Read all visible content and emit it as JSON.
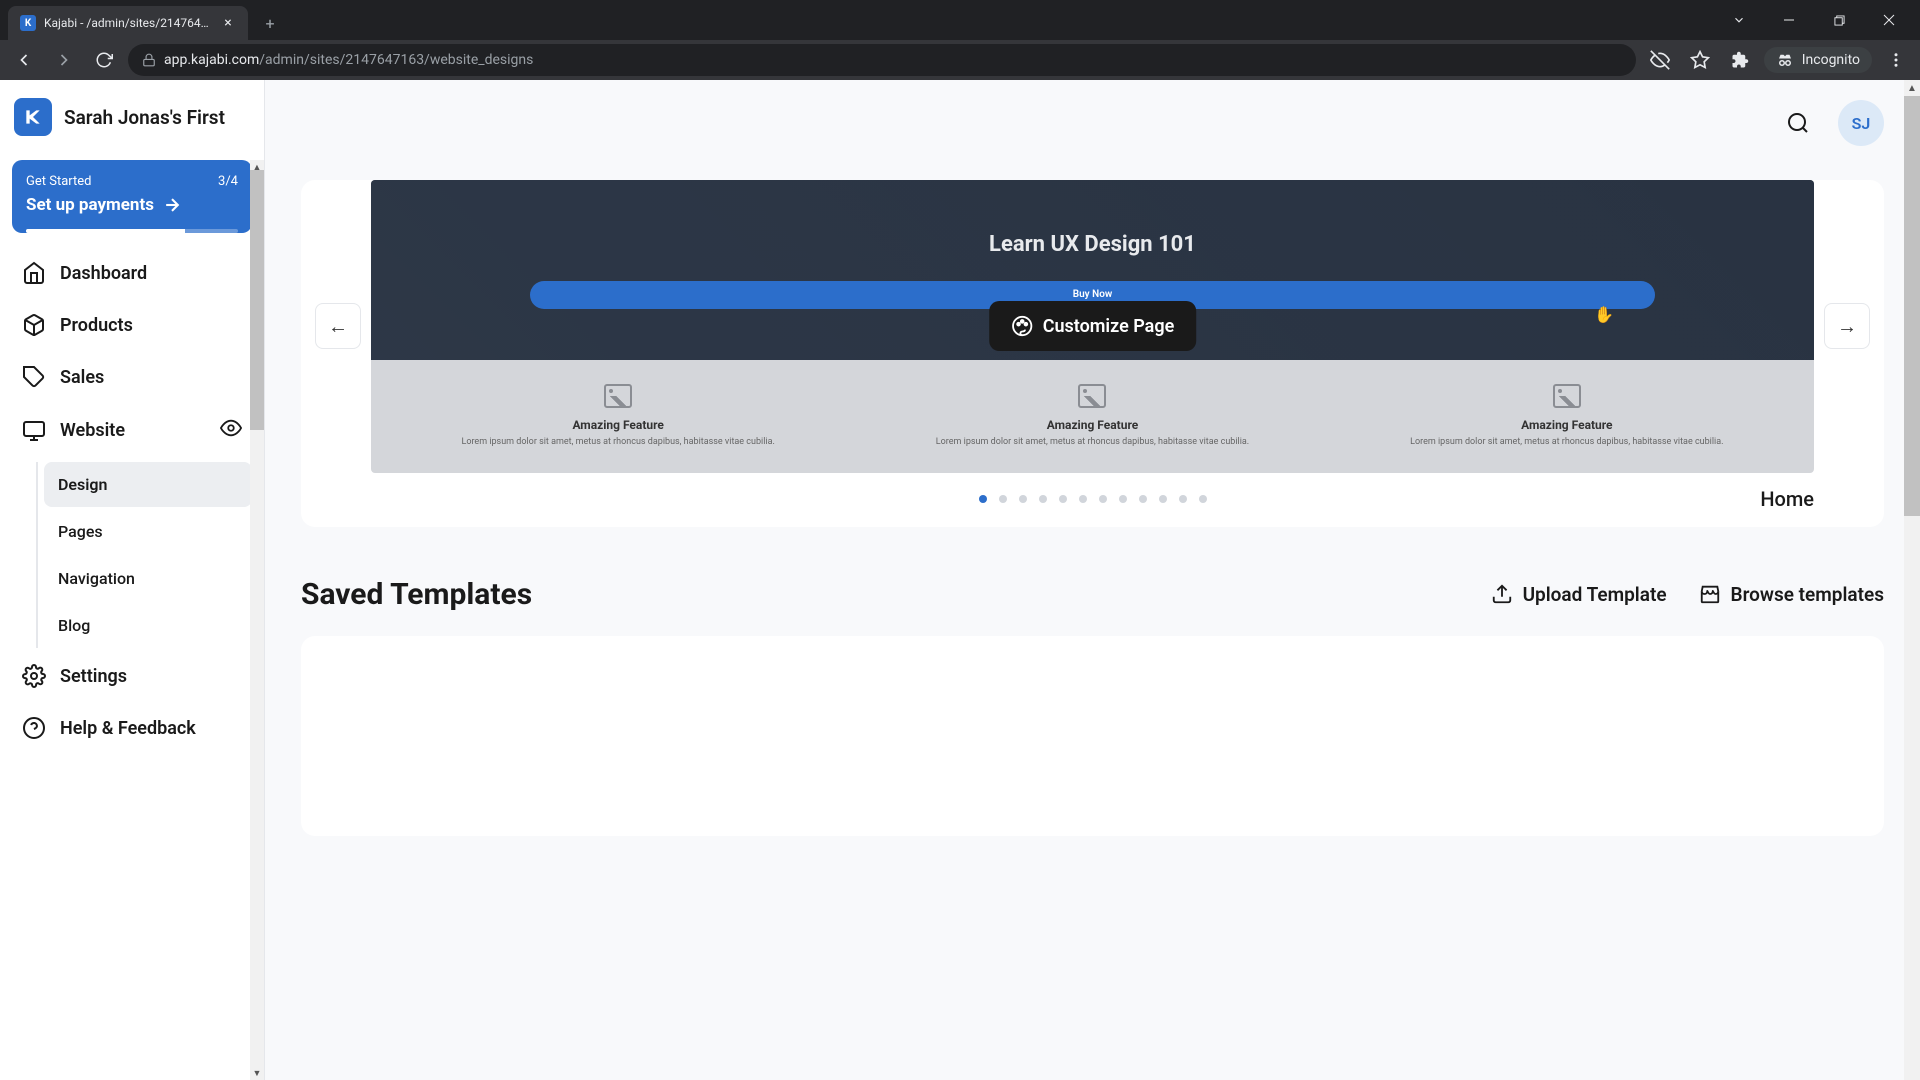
{
  "browser": {
    "tab_title": "Kajabi - /admin/sites/2147647163",
    "url_domain": "app.kajabi.com",
    "url_path": "/admin/sites/2147647163/website_designs",
    "incognito_label": "Incognito"
  },
  "sidebar": {
    "site_name": "Sarah Jonas's First",
    "get_started": {
      "label": "Get Started",
      "progress": "3/4",
      "action": "Set up payments"
    },
    "nav": {
      "dashboard": "Dashboard",
      "products": "Products",
      "sales": "Sales",
      "website": "Website",
      "settings": "Settings",
      "help": "Help & Feedback"
    },
    "website_sub": {
      "design": "Design",
      "pages": "Pages",
      "navigation": "Navigation",
      "blog": "Blog"
    }
  },
  "topbar": {
    "avatar_initials": "SJ"
  },
  "preview": {
    "hero_title": "Learn UX Design 101",
    "hero_cta": "Buy Now",
    "customize_label": "Customize Page",
    "features": [
      {
        "title": "Amazing Feature",
        "desc": "Lorem ipsum dolor sit amet, metus at rhoncus dapibus, habitasse vitae cubilia."
      },
      {
        "title": "Amazing Feature",
        "desc": "Lorem ipsum dolor sit amet, metus at rhoncus dapibus, habitasse vitae cubilia."
      },
      {
        "title": "Amazing Feature",
        "desc": "Lorem ipsum dolor sit amet, metus at rhoncus dapibus, habitasse vitae cubilia."
      }
    ],
    "page_name": "Home",
    "dot_count": 12,
    "active_dot": 0
  },
  "templates": {
    "heading": "Saved Templates",
    "upload_label": "Upload Template",
    "browse_label": "Browse templates"
  }
}
